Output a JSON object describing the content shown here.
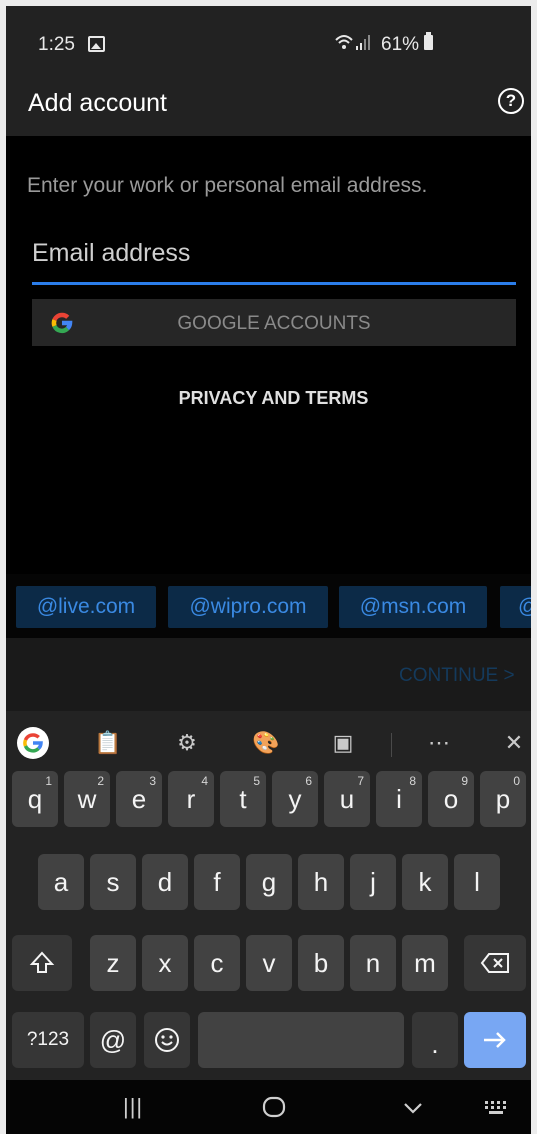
{
  "status_bar": {
    "time": "1:25",
    "battery": "61%"
  },
  "app_bar": {
    "title": "Add account",
    "help_icon": "question-circle-icon"
  },
  "content": {
    "prompt": "Enter your work or personal email address.",
    "email_placeholder": "Email address",
    "google_button_label": "GOOGLE ACCOUNTS",
    "privacy_label": "PRIVACY AND TERMS"
  },
  "domain_suggestions": [
    "@live.com",
    "@wipro.com",
    "@msn.com",
    "@"
  ],
  "continue_label": "CONTINUE >",
  "keyboard": {
    "toolbar_icons": [
      "google-icon",
      "clipboard-icon",
      "gear-icon",
      "palette-icon",
      "screenshot-icon",
      "more-icon",
      "mic-off-icon"
    ],
    "row1": [
      {
        "key": "q",
        "hint": "1"
      },
      {
        "key": "w",
        "hint": "2"
      },
      {
        "key": "e",
        "hint": "3"
      },
      {
        "key": "r",
        "hint": "4"
      },
      {
        "key": "t",
        "hint": "5"
      },
      {
        "key": "y",
        "hint": "6"
      },
      {
        "key": "u",
        "hint": "7"
      },
      {
        "key": "i",
        "hint": "8"
      },
      {
        "key": "o",
        "hint": "9"
      },
      {
        "key": "p",
        "hint": "0"
      }
    ],
    "row2": [
      "a",
      "s",
      "d",
      "f",
      "g",
      "h",
      "j",
      "k",
      "l"
    ],
    "row3": [
      "z",
      "x",
      "c",
      "v",
      "b",
      "n",
      "m"
    ],
    "symbols_label": "?123",
    "at_label": "@",
    "period_label": "."
  },
  "colors": {
    "accent": "#2b7de9",
    "chip_bg": "#0c2a47",
    "chip_text": "#3a89e2",
    "enter_key": "#78a7f3"
  }
}
